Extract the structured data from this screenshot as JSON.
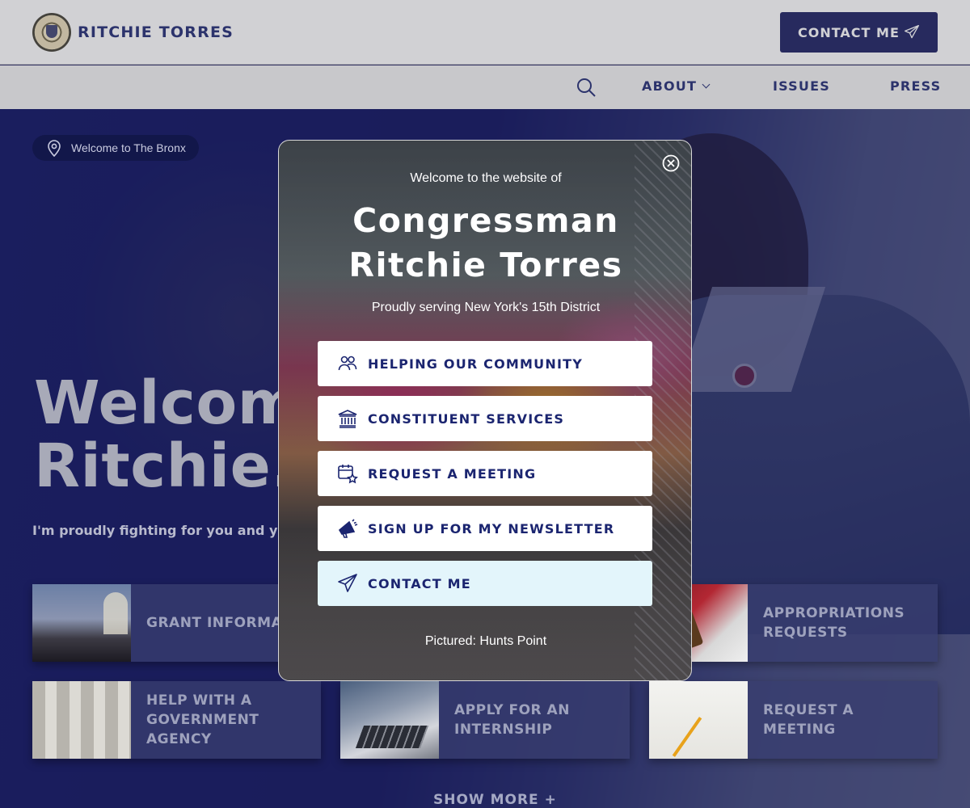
{
  "header": {
    "brand": "RITCHIE TORRES",
    "contact_label": "CONTACT ME"
  },
  "nav": {
    "about": "ABOUT",
    "issues": "ISSUES",
    "press": "PRESS"
  },
  "hero": {
    "location": "Welcome to The Bronx",
    "title_line1": "Welcome",
    "title_line2": "Ritchie.",
    "subtitle": "I'm proudly fighting for you and your"
  },
  "cards": [
    {
      "label": "GRANT INFORMATI"
    },
    {
      "label": "APPROPRIATIONS REQUESTS"
    },
    {
      "label": "HELP WITH A GOVERNMENT AGENCY"
    },
    {
      "label": "APPLY FOR AN INTERNSHIP"
    },
    {
      "label": "REQUEST A MEETING"
    }
  ],
  "show_more": "SHOW MORE +",
  "modal": {
    "pre_title": "Welcome to the website of",
    "title_line1": "Congressman",
    "title_line2": "Ritchie Torres",
    "subtitle": "Proudly serving New York's 15th District",
    "buttons": [
      {
        "label": "HELPING OUR COMMUNITY",
        "icon": "people-icon"
      },
      {
        "label": "CONSTITUENT SERVICES",
        "icon": "building-icon"
      },
      {
        "label": "REQUEST A MEETING",
        "icon": "calendar-star-icon"
      },
      {
        "label": "SIGN UP FOR MY NEWSLETTER",
        "icon": "megaphone-icon"
      },
      {
        "label": "CONTACT ME",
        "icon": "paper-plane-icon"
      }
    ],
    "caption": "Pictured: Hunts Point"
  },
  "colors": {
    "navy": "#1b2570",
    "button_dark": "#14185c",
    "contact_highlight": "#e3f5fb"
  }
}
